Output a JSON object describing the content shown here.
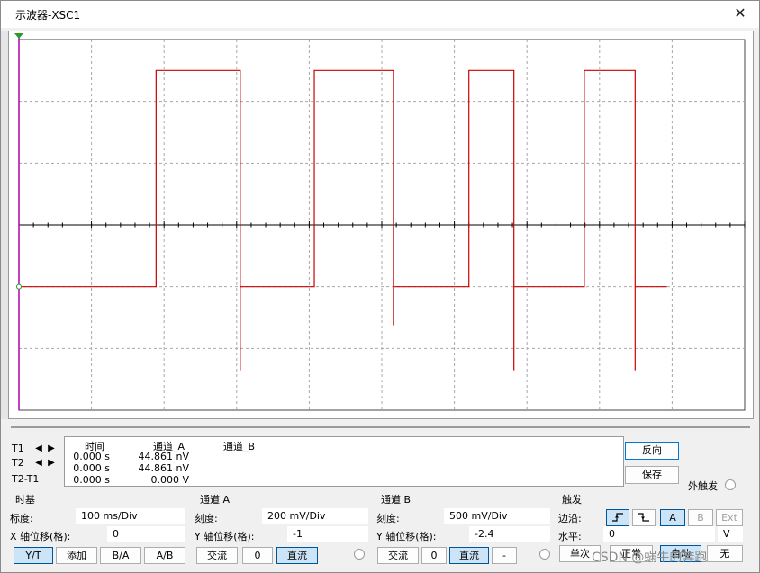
{
  "window": {
    "title": "示波器-XSC1",
    "close_icon": "close-icon"
  },
  "trace": {
    "color": "#cc0000",
    "baseline_div": -1,
    "high_div": 2.5,
    "transitions_div": [
      1.89,
      4.07,
      6.2,
      7.79
    ],
    "segments_div": [
      [
        0,
        1.89
      ],
      [
        3.05,
        4.07
      ],
      [
        5.16,
        6.2
      ],
      [
        6.82,
        7.79
      ]
    ],
    "spikes_div": [
      3.05,
      5.16,
      6.82,
      8.64
    ]
  },
  "cursors": {
    "t1": "T1",
    "t2": "T2",
    "t2t1": "T2-T1"
  },
  "readout": {
    "headers": {
      "time": "时间",
      "ch_a": "通道_A",
      "ch_b": "通道_B"
    },
    "rows": [
      {
        "time": "0.000 s",
        "ch_a": "44.861 nV"
      },
      {
        "time": "0.000 s",
        "ch_a": "44.861 nV"
      },
      {
        "time": "0.000 s",
        "ch_a": "0.000 V"
      }
    ]
  },
  "side": {
    "reverse": "反向",
    "save": "保存",
    "ext_trigger": "外触发"
  },
  "timebase": {
    "title": "时基",
    "scale_label": "标度:",
    "scale_value": "100 ms/Div",
    "xpos_label": "X 轴位移(格):",
    "xpos_value": "0",
    "yt": "Y/T",
    "add": "添加",
    "ba": "B/A",
    "ab": "A/B"
  },
  "channel_a": {
    "title": "通道 A",
    "scale_label": "刻度:",
    "scale_value": "200 mV/Div",
    "ypos_label": "Y 轴位移(格):",
    "ypos_value": "-1",
    "ac": "交流",
    "zero": "0",
    "dc": "直流"
  },
  "channel_b": {
    "title": "通道 B",
    "scale_label": "刻度:",
    "scale_value": "500 mV/Div",
    "ypos_label": "Y 轴位移(格):",
    "ypos_value": "-2.4",
    "ac": "交流",
    "zero": "0",
    "dc": "直流",
    "minus": "-"
  },
  "trigger": {
    "title": "触发",
    "edge_label": "边沿:",
    "rising_icon": "rising-edge-icon",
    "falling_icon": "falling-edge-icon",
    "a": "A",
    "b": "B",
    "ext": "Ext",
    "level_label": "水平:",
    "level_value": "0",
    "level_unit": "V",
    "single": "单次",
    "normal": "正常",
    "auto": "自动",
    "none": "无"
  },
  "watermark": "CSDN @蜗牛的奔跑"
}
